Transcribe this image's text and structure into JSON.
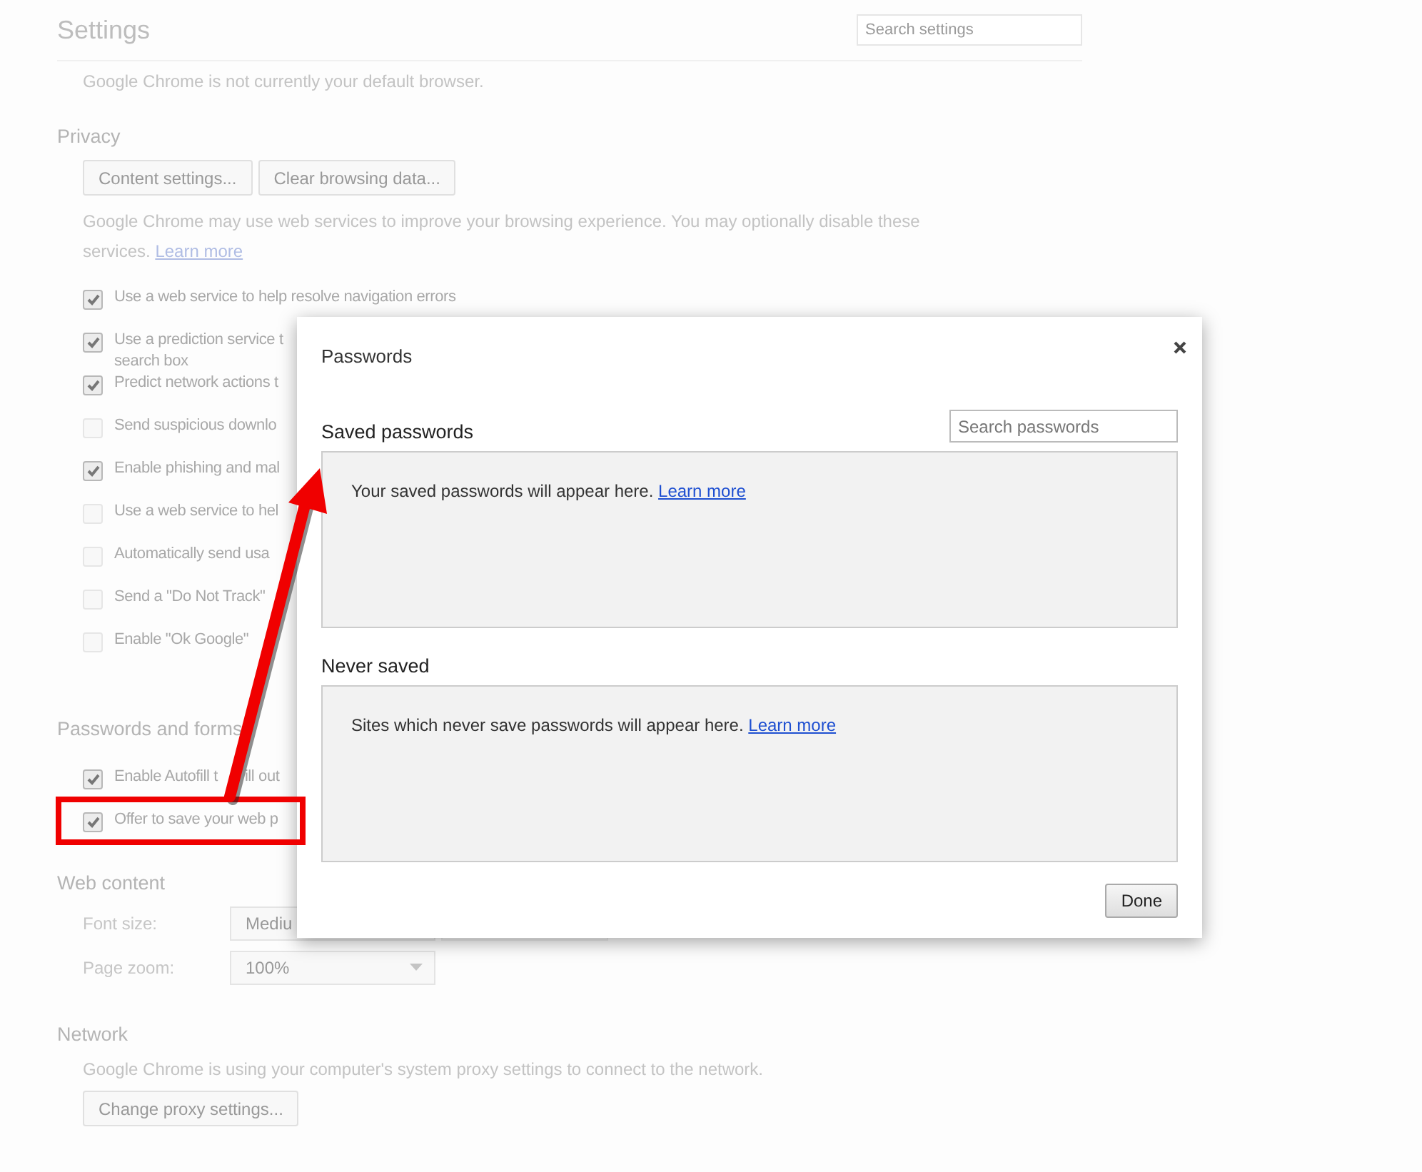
{
  "header": {
    "title": "Settings",
    "search": {
      "placeholder": "Search settings"
    }
  },
  "default_browser": {
    "text": "Google Chrome is not currently your default browser."
  },
  "privacy": {
    "heading": "Privacy",
    "buttons": [
      "Content settings...",
      "Clear browsing data..."
    ],
    "description": "Google Chrome may use web services to improve your browsing experience. You may optionally disable these services.",
    "link": "Learn more",
    "options": [
      {
        "label": "Use a web service to help resolve navigation errors",
        "checked": true
      },
      {
        "label": "Use a prediction service t",
        "line2": "search box",
        "checked": true
      },
      {
        "label": "Predict network actions t",
        "checked": true
      },
      {
        "label": "Send suspicious downlo",
        "checked": false
      },
      {
        "label": "Enable phishing and mal",
        "checked": true
      },
      {
        "label": "Use a web service to hel",
        "checked": false
      },
      {
        "label": "Automatically send usa",
        "checked": false
      },
      {
        "label": "Send a \"Do Not Track\"",
        "checked": false
      },
      {
        "label": "Enable \"Ok Google\"",
        "checked": false
      }
    ]
  },
  "passwords_and_forms": {
    "heading": "Passwords and forms",
    "options": [
      {
        "label": "Enable Autofill t",
        "tail": "ill out",
        "checked": true
      },
      {
        "label": "Offer to save your web p",
        "checked": true
      }
    ]
  },
  "web_content": {
    "heading": "Web content",
    "rows": [
      {
        "kind": "font",
        "label": "Font size:",
        "value": "Mediu"
      },
      {
        "kind": "zoom",
        "label": "Page zoom:",
        "value": "100%"
      }
    ]
  },
  "network": {
    "heading": "Network",
    "text": "Google Chrome is using your computer's system proxy settings to connect to the network.",
    "button": "Change proxy settings..."
  },
  "dialog": {
    "title": "Passwords",
    "sections": [
      {
        "heading": "Saved passwords",
        "search": {
          "placeholder": "Search passwords"
        },
        "message": "Your saved passwords will appear here.",
        "link": "Learn more"
      },
      {
        "heading": "Never saved",
        "message": "Sites which never save passwords will appear here.",
        "link": "Learn more"
      }
    ],
    "button": "Done"
  }
}
